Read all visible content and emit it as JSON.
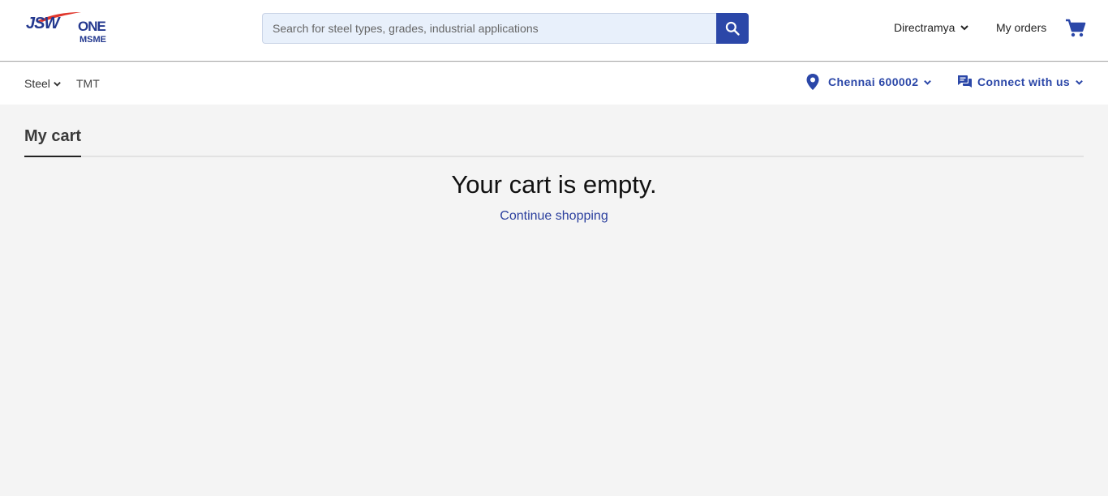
{
  "header": {
    "logo": {
      "brand": "JSW",
      "product": "ONE",
      "sub": "MSME"
    },
    "search": {
      "placeholder": "Search for steel types, grades, industrial applications",
      "value": ""
    },
    "user_label": "Directramya",
    "orders_label": "My orders",
    "icons": {
      "search": "search-icon",
      "cart": "cart-icon",
      "user_menu": "chevron-down-icon"
    }
  },
  "nav": {
    "items": [
      {
        "label": "Steel",
        "has_dropdown": true
      },
      {
        "label": "TMT",
        "has_dropdown": false
      }
    ],
    "location": "Chennai 600002",
    "connect": "Connect with us",
    "icons": {
      "location": "location-pin-icon",
      "connect": "chat-bubbles-icon"
    }
  },
  "main": {
    "tab": "My cart",
    "empty_message": "Your cart is empty.",
    "continue_link": "Continue shopping"
  },
  "colors": {
    "brand_blue": "#2b47a8",
    "logo_red": "#e0362c",
    "page_bg": "#f4f4f4"
  }
}
